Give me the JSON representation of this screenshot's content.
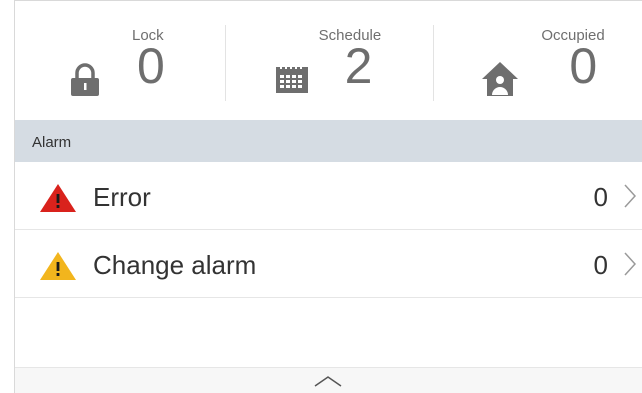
{
  "stats": {
    "lock": {
      "label": "Lock",
      "value": "0",
      "icon": "lock-icon"
    },
    "schedule": {
      "label": "Schedule",
      "value": "2",
      "icon": "calendar-icon"
    },
    "occupied": {
      "label": "Occupied",
      "value": "0",
      "icon": "house-person-icon"
    }
  },
  "alarm": {
    "header": "Alarm",
    "rows": [
      {
        "label": "Error",
        "count": "0",
        "icon": "error-warning-icon",
        "color": "#d9221c"
      },
      {
        "label": "Change alarm",
        "count": "0",
        "icon": "change-alarm-warning-icon",
        "color": "#f2b51d"
      }
    ]
  },
  "footer": {
    "icon": "chevron-up-icon"
  },
  "colors": {
    "header_band": "#d5dce3",
    "icon_gray": "#6e6e6e",
    "error_red": "#d9221c",
    "alarm_yellow": "#f2b51d"
  }
}
